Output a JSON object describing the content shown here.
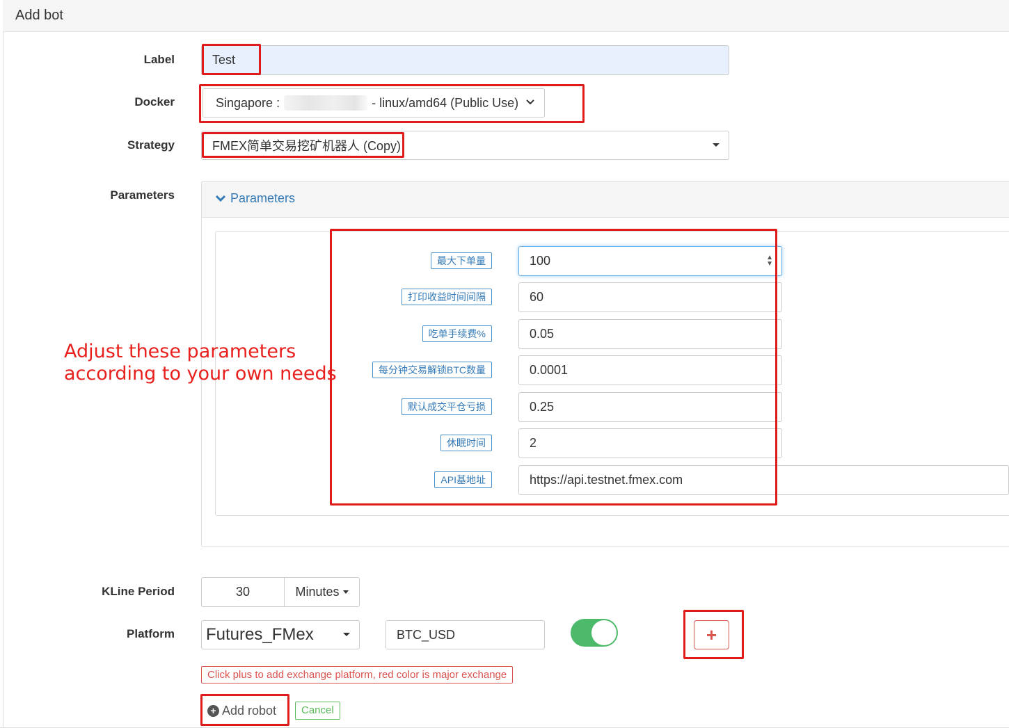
{
  "header": {
    "title": "Add bot"
  },
  "form": {
    "label": {
      "label": "Label",
      "value": "Test"
    },
    "docker": {
      "label": "Docker",
      "prefix": "Singapore :",
      "suffix": "- linux/amd64 (Public Use)"
    },
    "strategy": {
      "label": "Strategy",
      "value": "FMEX简单交易挖矿机器人 (Copy)"
    },
    "parameters": {
      "label": "Parameters",
      "panel_title": "Parameters",
      "items": [
        {
          "name": "最大下单量",
          "value": "100"
        },
        {
          "name": "打印收益时间间隔",
          "value": "60"
        },
        {
          "name": "吃单手续费%",
          "value": "0.05"
        },
        {
          "name": "每分钟交易解锁BTC数量",
          "value": "0.0001"
        },
        {
          "name": "默认成交平仓亏损",
          "value": "0.25"
        },
        {
          "name": "休眠时间",
          "value": "2"
        },
        {
          "name": "API基地址",
          "value": "https://api.testnet.fmex.com"
        }
      ]
    },
    "kline": {
      "label": "KLine Period",
      "value": "30",
      "unit": "Minutes"
    },
    "platform": {
      "label": "Platform",
      "exchange": "Futures_FMex",
      "pair": "BTC_USD",
      "enabled": true,
      "hint": "Click plus to add exchange platform, red color is major exchange"
    },
    "buttons": {
      "add": "Add robot",
      "cancel": "Cancel"
    }
  },
  "annotation": {
    "line1": "Adjust these parameters",
    "line2": "according to your own needs",
    "color": "#e8201e"
  },
  "colors": {
    "link": "#337ab7",
    "danger": "#d9534f",
    "success": "#5cb85c",
    "toggle": "#4cba6a"
  }
}
